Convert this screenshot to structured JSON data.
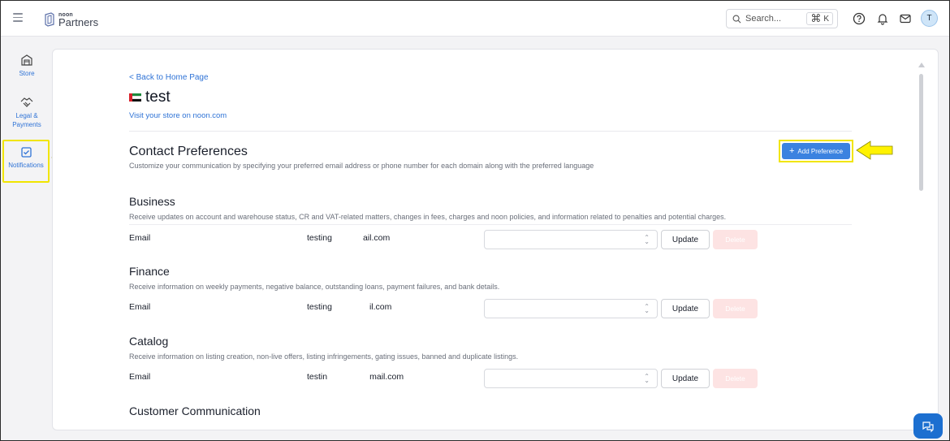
{
  "header": {
    "brand_small": "noon",
    "brand_name": "Partners",
    "search_placeholder": "Search...",
    "shortcut_symbol": "⌘",
    "shortcut_key": "K",
    "avatar_initial": "T",
    "icons": [
      "menu-icon",
      "search-icon",
      "help-icon",
      "bell-icon",
      "mail-icon"
    ]
  },
  "sidebar": {
    "items": [
      {
        "label": "Store",
        "icon": "store-icon"
      },
      {
        "label": "Legal & Payments",
        "icon": "handshake-icon"
      },
      {
        "label": "Notifications",
        "icon": "checkbox-icon",
        "active": true
      }
    ]
  },
  "page": {
    "back_link": "<  Back to Home Page",
    "store_name": "test",
    "visit_link": "Visit your store on noon.com",
    "section_title": "Contact Preferences",
    "section_subtitle": "Customize your communication by specifying your preferred email address or phone number for each domain along with the preferred language",
    "add_button": "Add Preference",
    "add_button_icon": "+"
  },
  "domains": [
    {
      "title": "Business",
      "description": "Receive updates on account and warehouse status, CR and VAT-related matters, changes in fees, charges and noon policies, and information related to penalties and potential charges.",
      "type": "Email",
      "value_start": "testing",
      "value_end": "ail.com",
      "update_label": "Update",
      "delete_label": "Delete"
    },
    {
      "title": "Finance",
      "description": "Receive information on weekly payments, negative balance, outstanding loans, payment failures, and bank details.",
      "type": "Email",
      "value_start": "testing",
      "value_end": "il.com",
      "update_label": "Update",
      "delete_label": "Delete"
    },
    {
      "title": "Catalog",
      "description": "Receive information on listing creation, non-live offers, listing infringements, gating issues, banned and duplicate listings.",
      "type": "Email",
      "value_start": "testin",
      "value_end": "mail.com",
      "update_label": "Update",
      "delete_label": "Delete"
    },
    {
      "title": "Customer Communication"
    }
  ],
  "colors": {
    "accent": "#2f73d6",
    "primary_button": "#3b82e0",
    "highlight": "#f1e500",
    "delete_disabled": "#fde3e3",
    "chat_button": "#1c6fd0"
  }
}
